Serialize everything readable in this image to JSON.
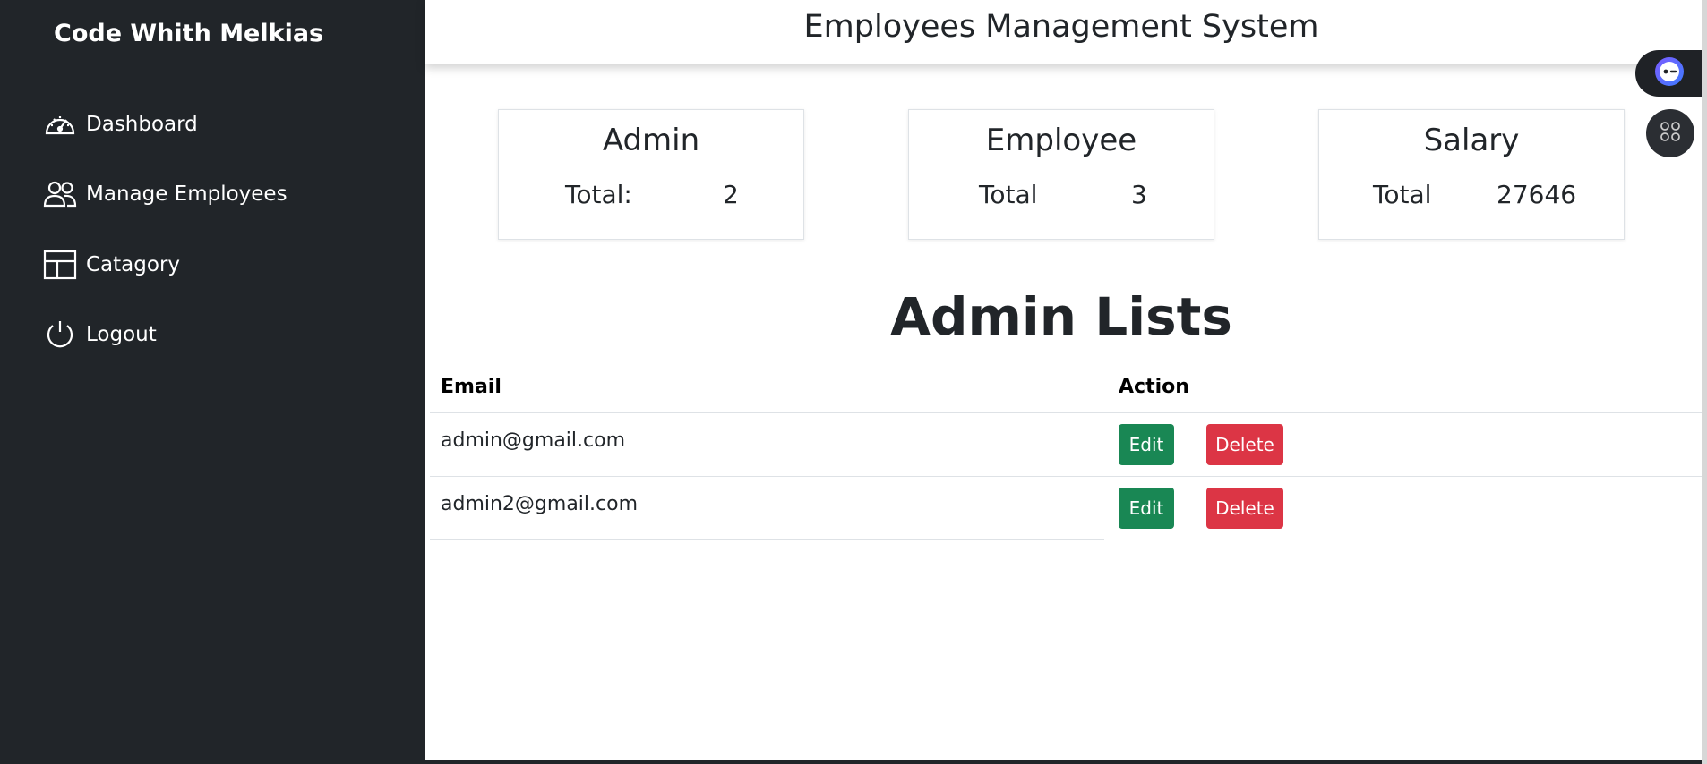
{
  "sidebar": {
    "brand": "Code Whith Melkias",
    "items": [
      {
        "label": "Dashboard",
        "icon": "speedometer-icon"
      },
      {
        "label": "Manage Employees",
        "icon": "people-icon"
      },
      {
        "label": "Catagory",
        "icon": "columns-icon"
      },
      {
        "label": "Logout",
        "icon": "power-icon"
      }
    ]
  },
  "header": {
    "title": "Employees Management System"
  },
  "cards": [
    {
      "title": "Admin",
      "label": "Total:",
      "value": "2"
    },
    {
      "title": "Employee",
      "label": "Total",
      "value": "3"
    },
    {
      "title": "Salary",
      "label": "Total",
      "value": "27646"
    }
  ],
  "admin_list": {
    "title": "Admin Lists",
    "columns": [
      "Email",
      "Action"
    ],
    "rows": [
      {
        "email": "admin@gmail.com",
        "edit": "Edit",
        "delete": "Delete"
      },
      {
        "email": "admin2@gmail.com",
        "edit": "Edit",
        "delete": "Delete"
      }
    ]
  },
  "colors": {
    "sidebar_bg": "#212529",
    "edit": "#198754",
    "delete": "#dc3545"
  }
}
